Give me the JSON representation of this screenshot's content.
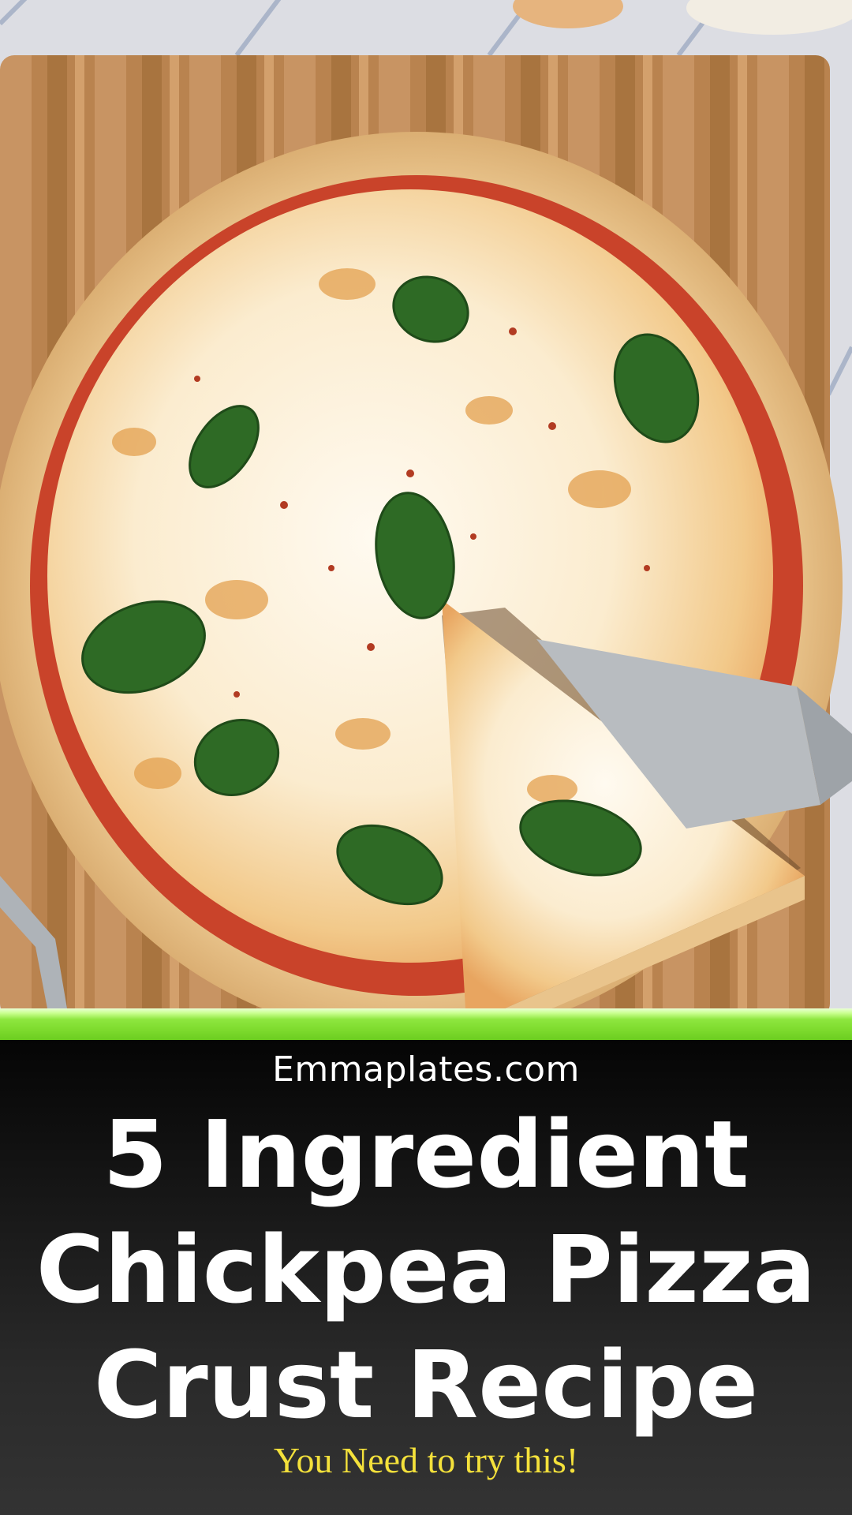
{
  "banner": {
    "site": "Emmaplates.com",
    "title": "5 Ingredient Chickpea Pizza Crust Recipe",
    "tagline": "You Need to try this!"
  },
  "colors": {
    "accent_bar": "#7fdc2f",
    "panel_background": "#1a1a1a",
    "title_text": "#ffffff",
    "tagline_text": "#f4e13b"
  }
}
